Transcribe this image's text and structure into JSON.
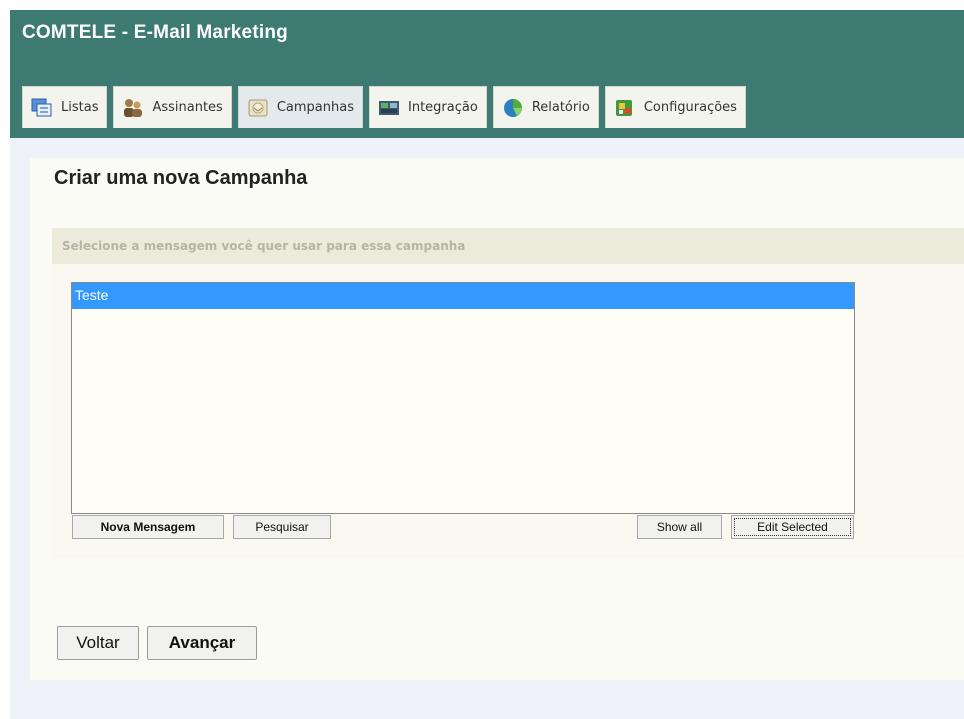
{
  "app": {
    "title": "COMTELE - E-Mail Marketing"
  },
  "tabs": [
    {
      "label": "Listas",
      "icon": "lists-icon",
      "active": false
    },
    {
      "label": "Assinantes",
      "icon": "subscribers-icon",
      "active": false
    },
    {
      "label": "Campanhas",
      "icon": "campaigns-icon",
      "active": true
    },
    {
      "label": "Integração",
      "icon": "integration-icon",
      "active": false
    },
    {
      "label": "Relatório",
      "icon": "report-icon",
      "active": false
    },
    {
      "label": "Configurações",
      "icon": "settings-icon",
      "active": false
    }
  ],
  "page": {
    "title": "Criar uma nova Campanha",
    "hint": "Selecione a mensagem você quer usar para essa campanha"
  },
  "messages": {
    "items": [
      "Teste"
    ],
    "selected": "Teste"
  },
  "list_buttons": {
    "new_message": "Nova Mensagem",
    "search": "Pesquisar",
    "show_all": "Show all",
    "edit_selected": "Edit Selected"
  },
  "nav": {
    "back": "Voltar",
    "next": "Avançar"
  },
  "colors": {
    "header": "#3d7a72",
    "selection": "#3399ff",
    "panel": "#fbfbf6",
    "hint_bar": "#eceadb"
  }
}
